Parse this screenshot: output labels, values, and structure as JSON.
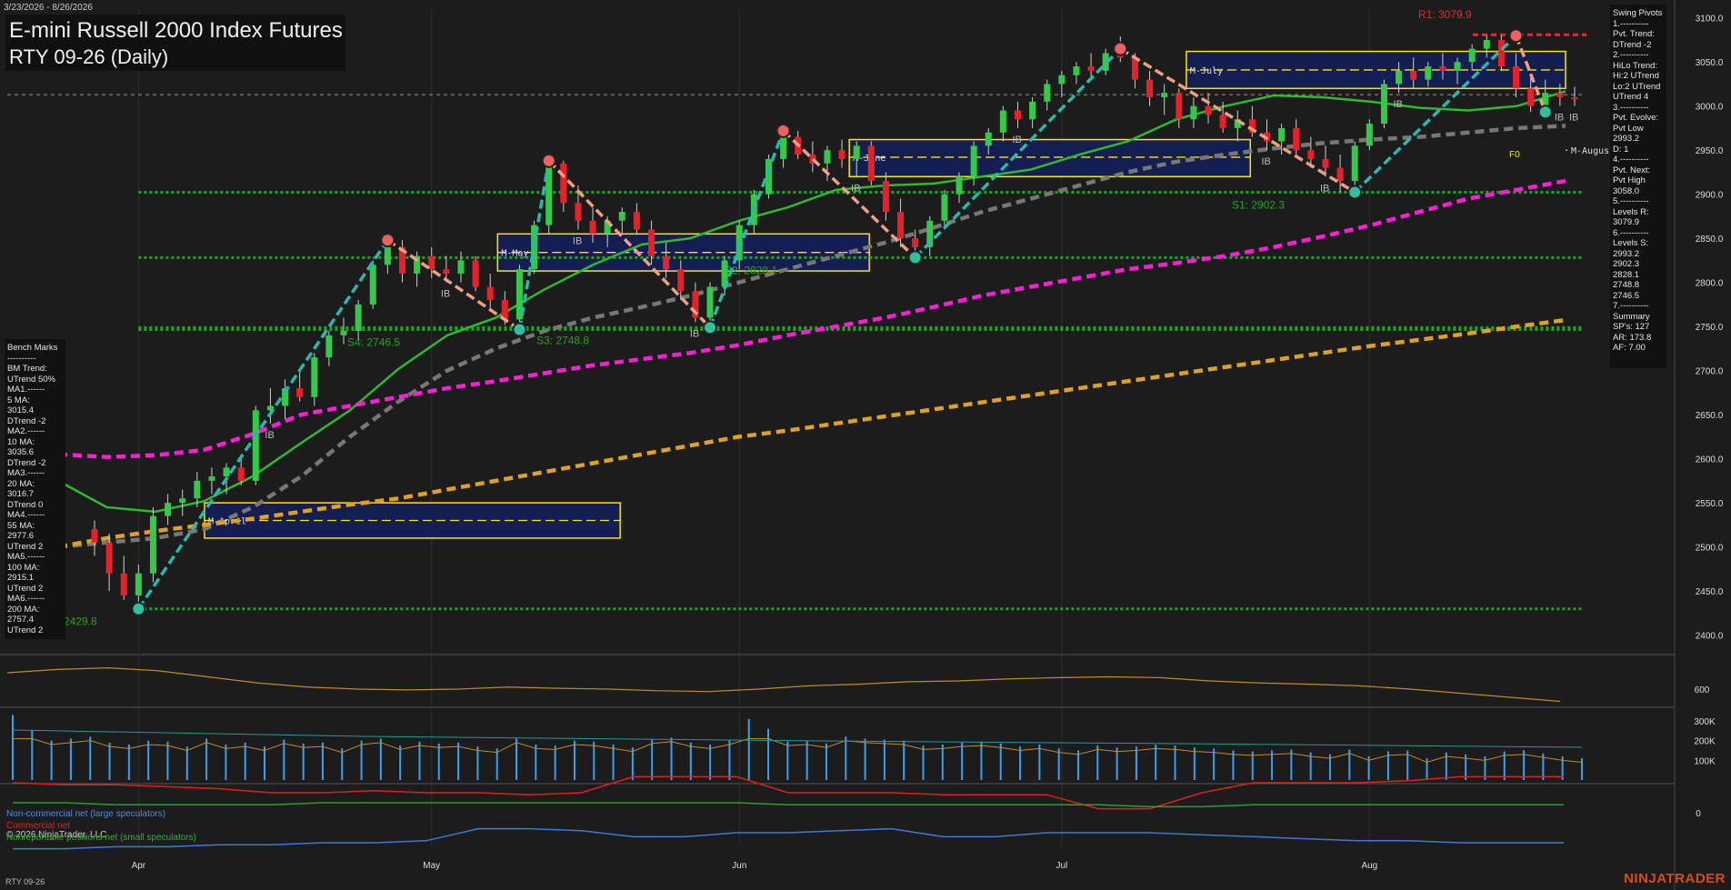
{
  "header": {
    "date_range": "3/23/2026 - 8/26/2026",
    "title_line1": "E-mini Russell 2000 Index Futures",
    "title_line2": "RTY 09-26 (Daily)"
  },
  "footer": {
    "symbol": "RTY 09-26",
    "brand": "NINJATRADER"
  },
  "swing_pivots_panel": {
    "lines": [
      "Swing Pivots",
      "1.----------",
      "Pvt. Trend:",
      "DTrend -2",
      "2.----------",
      "HiLo Trend:",
      "Hi:2 UTrend",
      "Lo:2 UTrend",
      "UTrend 4",
      "3.----------",
      "Pvt. Evolve:",
      "Pvt Low",
      "2993.2",
      "D: 1",
      "4.----------",
      "Pvt. Next:",
      "Pvt High",
      "3058.0",
      "5.----------",
      "Levels R:",
      "3079.9",
      "6.----------",
      "Levels S:",
      "2993.2",
      "2902.3",
      "2828.1",
      "2748.8",
      "2746.5",
      "7.----------",
      "Summary",
      "SP's: 127",
      "AR: 173.8",
      "AF: 7.00"
    ]
  },
  "bench_marks_panel": {
    "lines": [
      "Bench Marks",
      "----------",
      "BM Trend:",
      "UTrend 50%",
      "MA1.------",
      "5 MA:",
      "3015.4",
      "DTrend -2",
      "MA2.------",
      "10 MA:",
      "3035.6",
      "DTrend -2",
      "MA3.------",
      "20 MA:",
      "3016.7",
      "DTrend 0",
      "MA4.------",
      "55 MA:",
      "2977.6",
      "UTrend 2",
      "MA5.------",
      "100 MA:",
      "2915.1",
      "UTrend 2",
      "MA6.------",
      "200 MA:",
      "2757.4",
      "UTrend 2"
    ]
  },
  "cot_legend": {
    "noncommercial": "Non-commercial net (large speculators)",
    "commercial": "Commercial net",
    "copyright": "© 2026 NinjaTrader, LLC",
    "nonreportable": "Nonreportable positions net (small speculators)"
  },
  "colors": {
    "background": "#1c1c1c",
    "up_candle": "#33c94a",
    "down_candle": "#e8202a",
    "ma_green": "#2dbb2d",
    "ma_gray": "#777777",
    "ma_magenta": "#ff1ed8",
    "ma_orange": "#e0a020",
    "swing_up": "#28b8b0",
    "swing_down": "#f0a080",
    "support": "#1fa51f",
    "resistance": "#ff2020",
    "month_box_fill": "#141e5a",
    "month_box_border": "#ffe600",
    "volume_bar": "#3aa0f0"
  },
  "chart_data": [
    {
      "type": "candlestick",
      "title": "E-mini Russell 2000 Index Futures RTY 09-26 (Daily)",
      "ylim": [
        2380,
        3110
      ],
      "y_ticks": [
        "3100.0",
        "3050.0",
        "3000.0",
        "2950.0",
        "2900.0",
        "2850.0",
        "2800.0",
        "2750.0",
        "2700.0",
        "2650.0",
        "2600.0",
        "2550.0",
        "2500.0",
        "2450.0",
        "2400.0"
      ],
      "x_ticks": [
        "Apr",
        "May",
        "Jun",
        "Jul",
        "Aug"
      ],
      "ohlc": [
        [
          2520,
          2530,
          2490,
          2505
        ],
        [
          2505,
          2515,
          2450,
          2470
        ],
        [
          2470,
          2490,
          2440,
          2445
        ],
        [
          2445,
          2480,
          2429.8,
          2470
        ],
        [
          2470,
          2545,
          2460,
          2535
        ],
        [
          2535,
          2560,
          2525,
          2550
        ],
        [
          2550,
          2565,
          2535,
          2555
        ],
        [
          2555,
          2585,
          2545,
          2575
        ],
        [
          2575,
          2590,
          2560,
          2580
        ],
        [
          2580,
          2595,
          2560,
          2590
        ],
        [
          2590,
          2600,
          2570,
          2575
        ],
        [
          2575,
          2660,
          2570,
          2655
        ],
        [
          2655,
          2680,
          2640,
          2660
        ],
        [
          2660,
          2690,
          2645,
          2680
        ],
        [
          2680,
          2700,
          2665,
          2670
        ],
        [
          2670,
          2720,
          2660,
          2715
        ],
        [
          2715,
          2745,
          2705,
          2740
        ],
        [
          2740,
          2760,
          2730,
          2745
        ],
        [
          2745,
          2780,
          2735,
          2775
        ],
        [
          2775,
          2825,
          2770,
          2820
        ],
        [
          2820,
          2845,
          2810,
          2840
        ],
        [
          2840,
          2848,
          2800,
          2810
        ],
        [
          2810,
          2835,
          2795,
          2830
        ],
        [
          2830,
          2840,
          2805,
          2815
        ],
        [
          2815,
          2830,
          2800,
          2810
        ],
        [
          2810,
          2835,
          2800,
          2825
        ],
        [
          2825,
          2830,
          2790,
          2795
        ],
        [
          2795,
          2810,
          2770,
          2780
        ],
        [
          2780,
          2790,
          2752,
          2758
        ],
        [
          2758,
          2820,
          2746.5,
          2815
        ],
        [
          2815,
          2870,
          2810,
          2865
        ],
        [
          2865,
          2940,
          2855,
          2935
        ],
        [
          2935,
          2938,
          2880,
          2890
        ],
        [
          2890,
          2910,
          2860,
          2870
        ],
        [
          2870,
          2885,
          2845,
          2855
        ],
        [
          2855,
          2875,
          2840,
          2870
        ],
        [
          2870,
          2885,
          2855,
          2880
        ],
        [
          2880,
          2890,
          2855,
          2860
        ],
        [
          2860,
          2870,
          2820,
          2830
        ],
        [
          2830,
          2845,
          2805,
          2815
        ],
        [
          2815,
          2825,
          2780,
          2790
        ],
        [
          2790,
          2800,
          2755,
          2760
        ],
        [
          2760,
          2800,
          2748.8,
          2795
        ],
        [
          2795,
          2830,
          2785,
          2825
        ],
        [
          2825,
          2870,
          2815,
          2865
        ],
        [
          2865,
          2905,
          2855,
          2900
        ],
        [
          2900,
          2945,
          2895,
          2940
        ],
        [
          2940,
          2970,
          2930,
          2965
        ],
        [
          2965,
          2972,
          2940,
          2945
        ],
        [
          2945,
          2960,
          2925,
          2935
        ],
        [
          2935,
          2955,
          2915,
          2950
        ],
        [
          2950,
          2962,
          2930,
          2940
        ],
        [
          2940,
          2960,
          2920,
          2955
        ],
        [
          2955,
          2960,
          2910,
          2915
        ],
        [
          2915,
          2925,
          2870,
          2880
        ],
        [
          2880,
          2895,
          2840,
          2850
        ],
        [
          2850,
          2860,
          2828.1,
          2840
        ],
        [
          2840,
          2875,
          2830,
          2870
        ],
        [
          2870,
          2905,
          2860,
          2900
        ],
        [
          2900,
          2925,
          2890,
          2920
        ],
        [
          2920,
          2960,
          2910,
          2955
        ],
        [
          2955,
          2975,
          2945,
          2970
        ],
        [
          2970,
          3000,
          2960,
          2995
        ],
        [
          2995,
          3005,
          2975,
          2985
        ],
        [
          2985,
          3010,
          2975,
          3005
        ],
        [
          3005,
          3030,
          2995,
          3025
        ],
        [
          3025,
          3040,
          3010,
          3035
        ],
        [
          3035,
          3050,
          3025,
          3045
        ],
        [
          3045,
          3060,
          3030,
          3040
        ],
        [
          3040,
          3065,
          3035,
          3060
        ],
        [
          3060,
          3079,
          3050,
          3055
        ],
        [
          3055,
          3060,
          3020,
          3030
        ],
        [
          3030,
          3040,
          3000,
          3010
        ],
        [
          3010,
          3025,
          2990,
          3015
        ],
        [
          3015,
          3020,
          2975,
          2985
        ],
        [
          2985,
          3010,
          2975,
          3000
        ],
        [
          3000,
          3015,
          2980,
          2990
        ],
        [
          2990,
          3005,
          2970,
          2975
        ],
        [
          2975,
          2995,
          2960,
          2985
        ],
        [
          2985,
          3000,
          2965,
          2970
        ],
        [
          2970,
          2985,
          2950,
          2960
        ],
        [
          2960,
          2980,
          2945,
          2975
        ],
        [
          2975,
          2985,
          2945,
          2950
        ],
        [
          2950,
          2965,
          2930,
          2940
        ],
        [
          2940,
          2955,
          2920,
          2930
        ],
        [
          2930,
          2945,
          2902.3,
          2915
        ],
        [
          2915,
          2960,
          2905,
          2955
        ],
        [
          2955,
          2985,
          2950,
          2980
        ],
        [
          2980,
          3030,
          2975,
          3025
        ],
        [
          3025,
          3050,
          3015,
          3040
        ],
        [
          3040,
          3055,
          3020,
          3030
        ],
        [
          3030,
          3050,
          3022,
          3045
        ],
        [
          3045,
          3060,
          3030,
          3040
        ],
        [
          3040,
          3055,
          3025,
          3050
        ],
        [
          3050,
          3070,
          3040,
          3065
        ],
        [
          3065,
          3080,
          3055,
          3075
        ],
        [
          3075,
          3079.9,
          3040,
          3045
        ],
        [
          3045,
          3060,
          3010,
          3020
        ],
        [
          3020,
          3035,
          2993.2,
          3000
        ],
        [
          3000,
          3030,
          2995,
          3015
        ],
        [
          3015,
          3025,
          3000,
          3010
        ],
        [
          3010,
          3022,
          3000,
          3008
        ]
      ],
      "moving_averages": [
        {
          "name": "MA 20",
          "color": "#2dbb2d",
          "values": [
            2575,
            2545,
            2540,
            2552,
            2580,
            2618,
            2655,
            2702,
            2740,
            2760,
            2792,
            2820,
            2843,
            2850,
            2870,
            2885,
            2905,
            2910,
            2912,
            2920,
            2928,
            2945,
            2960,
            2985,
            3000,
            3012,
            3010,
            3005,
            2998,
            2995,
            3000,
            3016.7
          ]
        },
        {
          "name": "MA 55",
          "color": "#777777",
          "values": [
            2500,
            2505,
            2510,
            2520,
            2545,
            2580,
            2625,
            2665,
            2700,
            2725,
            2745,
            2760,
            2772,
            2785,
            2800,
            2815,
            2830,
            2845,
            2862,
            2880,
            2895,
            2910,
            2925,
            2937,
            2945,
            2952,
            2958,
            2962,
            2965,
            2970,
            2975,
            2977.6
          ]
        },
        {
          "name": "MA 100",
          "color": "#ff1ed8",
          "values": [
            2605,
            2602,
            2604,
            2610,
            2628,
            2650,
            2660,
            2670,
            2680,
            2688,
            2697,
            2706,
            2713,
            2720,
            2729,
            2740,
            2750,
            2760,
            2772,
            2785,
            2795,
            2805,
            2815,
            2822,
            2830,
            2840,
            2852,
            2865,
            2880,
            2895,
            2905,
            2915.1
          ]
        },
        {
          "name": "MA 200",
          "color": "#e0a020",
          "values": [
            2500,
            2510,
            2518,
            2525,
            2532,
            2540,
            2548,
            2555,
            2565,
            2575,
            2585,
            2595,
            2605,
            2615,
            2625,
            2632,
            2640,
            2648,
            2656,
            2664,
            2672,
            2680,
            2688,
            2696,
            2704,
            2712,
            2720,
            2728,
            2735,
            2742,
            2750,
            2757.4
          ]
        }
      ],
      "swing_pivots": [
        2429.8,
        2848,
        2746.5,
        2938,
        2748.8,
        2972,
        2828.1,
        3065,
        2902.3,
        3079.9,
        2993.2
      ],
      "levels": {
        "resistance": [
          {
            "label": "R1: 3079.9",
            "value": 3079.9
          }
        ],
        "support": [
          {
            "label": "S1: 2902.3",
            "value": 2902.3
          },
          {
            "label": "S2: 2828.1",
            "value": 2828.1
          },
          {
            "label": "S3: 2748.8",
            "value": 2748.8
          },
          {
            "label": "S4: 2746.5",
            "value": 2746.5
          },
          {
            "label": "2429.8",
            "value": 2429.8
          }
        ]
      },
      "monthly_boxes": [
        {
          "label": "M-April",
          "top": 2550,
          "bottom": 2510,
          "mid": 2530
        },
        {
          "label": "M-May",
          "top": 2855,
          "bottom": 2813,
          "mid": 2834
        },
        {
          "label": "M-June",
          "top": 2962,
          "bottom": 2920,
          "mid": 2942
        },
        {
          "label": "M-July",
          "top": 3062,
          "bottom": 3020,
          "mid": 3041
        },
        {
          "label": "M-August",
          "top": 2966,
          "bottom": 2927,
          "mid": 2950
        }
      ],
      "box_label_extra": "F0",
      "inside_bar_label": "IB"
    },
    {
      "type": "line",
      "y_ticks": [
        "600"
      ],
      "values": [
        640,
        648,
        652,
        645,
        630,
        615,
        605,
        600,
        598,
        600,
        605,
        602,
        600,
        596,
        594,
        600,
        608,
        612,
        618,
        620,
        625,
        628,
        630,
        628,
        620,
        615,
        612,
        608,
        600,
        590,
        580,
        570
      ]
    },
    {
      "type": "bar",
      "y_ticks": [
        "300K",
        "200K",
        "100K"
      ],
      "values": [
        330,
        250,
        200,
        210,
        220,
        190,
        180,
        200,
        195,
        170,
        210,
        180,
        190,
        170,
        205,
        185,
        190,
        160,
        200,
        210,
        175,
        195,
        185,
        190,
        170,
        160,
        210,
        180,
        175,
        200,
        195,
        180,
        165,
        205,
        215,
        190,
        180,
        200,
        310,
        260,
        195,
        200,
        185,
        220,
        210,
        205,
        200,
        175,
        180,
        190,
        195,
        185,
        170,
        180,
        160,
        150,
        175,
        165,
        170,
        180,
        175,
        165,
        160,
        150,
        145,
        150,
        155,
        140,
        130,
        155,
        120,
        145,
        150,
        110,
        140,
        130,
        120,
        145,
        150,
        135,
        120,
        110
      ]
    },
    {
      "type": "line",
      "y_ticks": [
        "0"
      ],
      "series": [
        {
          "name": "Non-commercial net (large speculators)",
          "color": "#3a7ad8",
          "values": [
            -18,
            -18,
            -17,
            -17,
            -16,
            -16,
            -15,
            -15,
            -14,
            -8,
            -8,
            -9,
            -12,
            -12,
            -10,
            -10,
            -9,
            -8,
            -12,
            -12,
            -10,
            -10,
            -10,
            -11,
            -12,
            -13,
            -14,
            -14,
            -15,
            -15,
            -15
          ]
        },
        {
          "name": "Commercial net",
          "color": "#e0201a",
          "values": [
            15,
            14,
            14,
            13,
            12,
            10,
            10,
            11,
            10,
            10,
            9,
            10,
            18,
            18,
            18,
            10,
            10,
            10,
            9,
            9,
            9,
            2,
            2,
            10,
            15,
            15,
            15,
            16,
            18,
            18,
            18
          ]
        },
        {
          "name": "Nonreportable positions net (small speculators)",
          "color": "#2aa02a",
          "values": [
            5,
            5,
            4,
            4,
            4,
            4,
            5,
            5,
            5,
            5,
            5,
            5,
            5,
            5,
            5,
            4,
            4,
            4,
            4,
            4,
            4,
            4,
            3,
            3,
            4,
            4,
            4,
            4,
            4,
            4,
            4
          ]
        }
      ]
    }
  ]
}
